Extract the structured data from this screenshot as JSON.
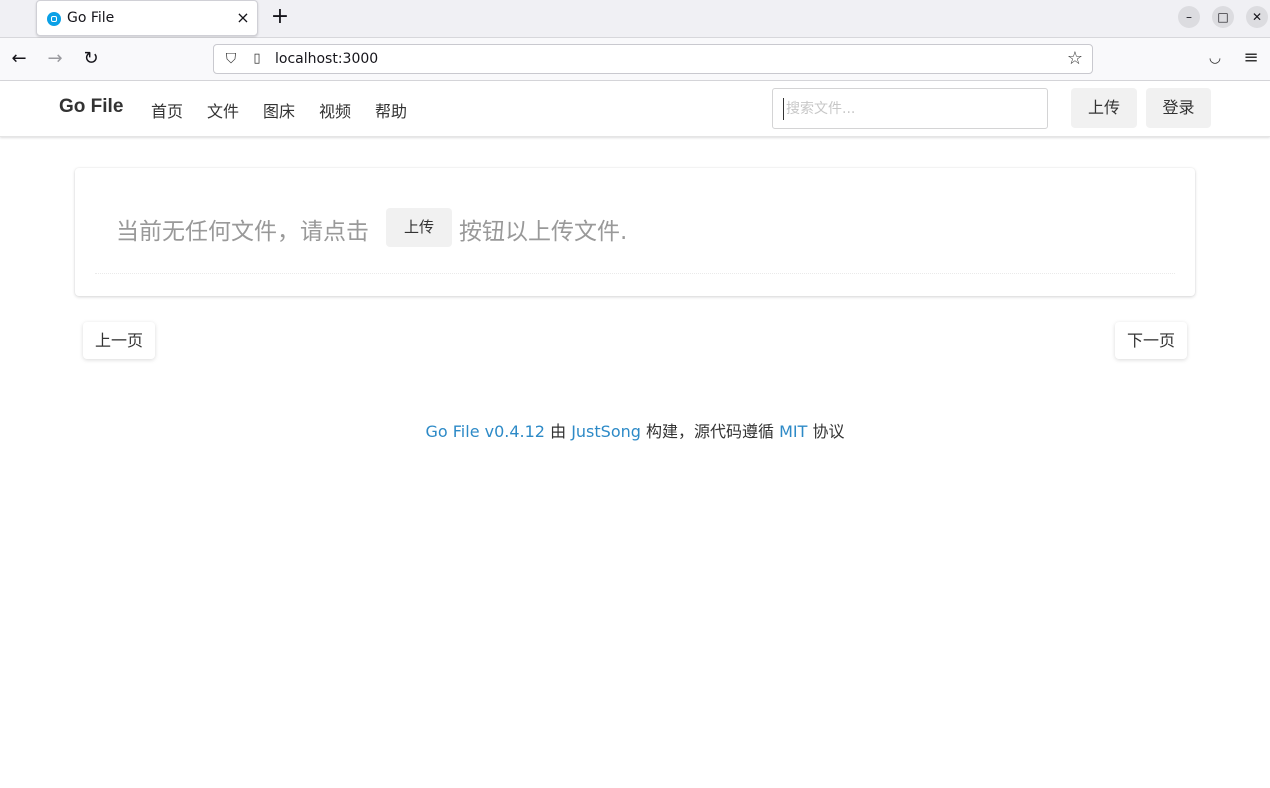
{
  "browser": {
    "tab_title": "Go File",
    "url": "localhost:3000",
    "icons": {
      "tab_close": "×",
      "new_tab": "+",
      "back": "←",
      "forward": "→",
      "reload": "↻",
      "shield": "⛉",
      "page": "▯",
      "star": "☆",
      "pocket": "◡",
      "menu": "≡",
      "minimize": "–",
      "maximize": "□",
      "close": "✕"
    }
  },
  "header": {
    "brand": "Go File",
    "menu": [
      "首页",
      "文件",
      "图床",
      "视频",
      "帮助"
    ],
    "search_placeholder": "搜索文件...",
    "upload_label": "上传",
    "login_label": "登录"
  },
  "main": {
    "empty_text_before": "当前无任何文件，请点击",
    "empty_upload_label": "上传",
    "empty_text_after": "按钮以上传文件.",
    "prev_label": "上一页",
    "next_label": "下一页"
  },
  "footer": {
    "app_link": "Go File v0.4.12",
    "by": "由",
    "author_link": "JustSong",
    "built": "构建，源代码遵循",
    "license_link": "MIT",
    "protocol": "协议"
  },
  "colors": {
    "link": "#2d8ac7",
    "button_bg": "#f1f1f1",
    "favicon": "#0aa0e6"
  }
}
